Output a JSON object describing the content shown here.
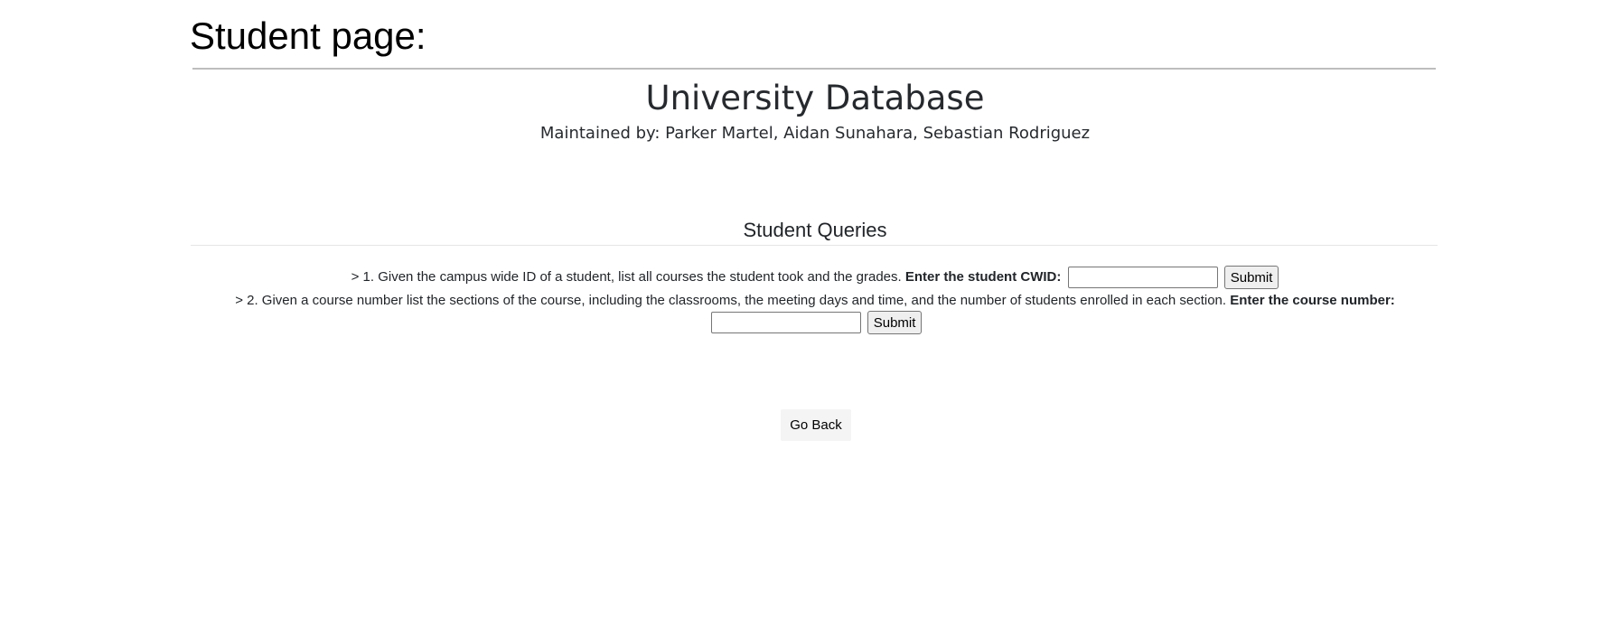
{
  "page": {
    "heading": "Student page:"
  },
  "header": {
    "title": "University Database",
    "maintainers": "Maintained by: Parker Martel, Aidan Sunahara, Sebastian Rodriguez"
  },
  "queries": {
    "title": "Student Queries",
    "q1": {
      "text": "> 1. Given the campus wide ID of a student, list all courses the student took and the grades.",
      "prompt": "Enter the student CWID:",
      "input_value": "",
      "submit_label": "Submit"
    },
    "q2": {
      "text": "> 2. Given a course number list the sections of the course, including the classrooms, the meeting days and time, and the number of students enrolled in each section.",
      "prompt": "Enter the course number:",
      "input_value": "",
      "submit_label": "Submit"
    }
  },
  "navigation": {
    "go_back_label": "Go Back"
  }
}
